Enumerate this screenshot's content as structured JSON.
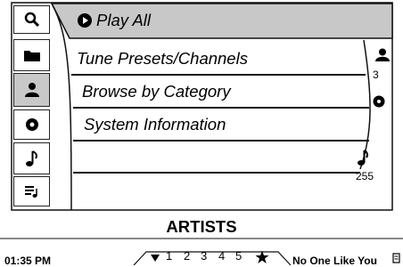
{
  "menu": {
    "items": [
      {
        "label": "Play All",
        "icon": "play-circle-icon",
        "active": true
      },
      {
        "label": "Tune Presets/Channels",
        "icon": "folder-icon",
        "active": false
      },
      {
        "label": "Browse by Category",
        "icon": "person-icon",
        "active": false
      },
      {
        "label": "System Information",
        "icon": "disc-icon",
        "active": false
      }
    ]
  },
  "left_tabs": [
    {
      "icon": "search-icon"
    },
    {
      "icon": "folder-icon"
    },
    {
      "icon": "person-icon",
      "active": true
    },
    {
      "icon": "disc-icon"
    },
    {
      "icon": "music-note-icon"
    },
    {
      "icon": "playlist-icon"
    }
  ],
  "scrollbar": {
    "top_value": "3",
    "bottom_value": "255"
  },
  "screen_title": "ARTISTS",
  "status": {
    "time": "01:35 PM",
    "preset_numbers": [
      "1",
      "2",
      "3",
      "4",
      "5"
    ],
    "now_playing": "No One Like You"
  }
}
